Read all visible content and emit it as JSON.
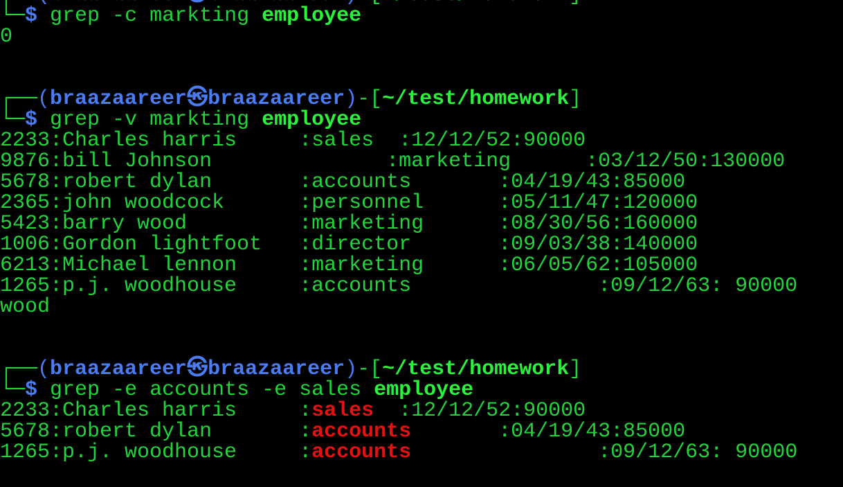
{
  "colors": {
    "background": "#000000",
    "output_green": "#22d33c",
    "prompt_blue": "#4a7cf3",
    "path_green": "#2bf23c",
    "match_red": "#e51010"
  },
  "prompt": {
    "corner_top": "┌──",
    "corner_bottom": "└─",
    "open_paren": "(",
    "user": "braazaareer",
    "at_symbol": "㉿",
    "host": "braazaareer",
    "close_paren": ")",
    "dash_bracket": "-[",
    "path": "~/test/homework",
    "close_bracket": "]",
    "dollar": "$"
  },
  "blocks": [
    {
      "command": "grep -c markting",
      "file": "employee",
      "output": [
        "0"
      ]
    },
    {
      "command": "grep -v markting",
      "file": "employee",
      "output": [
        "2233:Charles harris     :sales  :12/12/52:90000",
        "9876:bill Johnson              :marketing      :03/12/50:130000",
        "5678:robert dylan       :accounts       :04/19/43:85000",
        "2365:john woodcock      :personnel      :05/11/47:120000",
        "5423:barry wood         :marketing      :08/30/56:160000",
        "1006:Gordon lightfoot   :director       :09/03/38:140000",
        "6213:Michael lennon     :marketing      :06/05/62:105000",
        "1265:p.j. woodhouse     :accounts               :09/12/63: 90000",
        "wood"
      ]
    },
    {
      "command": "grep -e accounts -e sales",
      "file": "employee",
      "output_matches": [
        {
          "prefix": "2233:Charles harris     :",
          "match": "sales",
          "suffix": "  :12/12/52:90000"
        },
        {
          "prefix": "5678:robert dylan       :",
          "match": "accounts",
          "suffix": "       :04/19/43:85000"
        },
        {
          "prefix": "1265:p.j. woodhouse     :",
          "match": "accounts",
          "suffix": "               :09/12/63: 90000"
        }
      ]
    }
  ]
}
